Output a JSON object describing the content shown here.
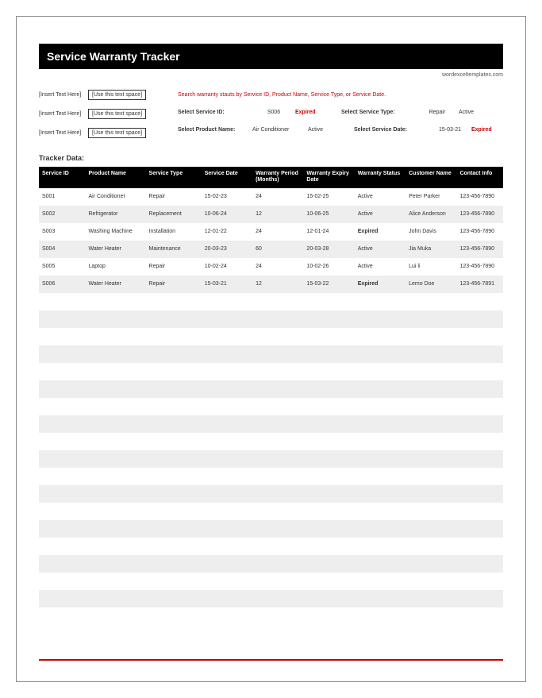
{
  "header": {
    "title": "Service Warranty Tracker",
    "source": "wordexceltemplates.com"
  },
  "left_filters": [
    {
      "label": "[Insert Text Here]",
      "box": "[Use this text space]"
    },
    {
      "label": "[Insert Text Here]",
      "box": "[Use this text space]"
    },
    {
      "label": "[Insert Text Here]",
      "box": "[Use this text space]"
    }
  ],
  "search": {
    "hint": "Search warranty stauts by Service ID, Product Name, Service Type, or Service Date.",
    "row1": {
      "label1": "Select Service ID:",
      "val1": "S006",
      "status1": "Expired",
      "label2": "Select Service Type:",
      "val2": "Repair",
      "status2": "Active"
    },
    "row2": {
      "label1": "Select Product Name:",
      "val1": "Air Conditioner",
      "status1": "Active",
      "label2": "Select Service Date:",
      "val2": "15-03-21",
      "status2": "Expired"
    }
  },
  "section_label": "Tracker Data:",
  "columns": {
    "c1": "Service ID",
    "c2": "Product Name",
    "c3": "Service Type",
    "c4": "Service Date",
    "c5": "Warranty Period (Months)",
    "c6": "Warranty Expiry Date",
    "c7": "Warranty Status",
    "c8": "Customer Name",
    "c9": "Contact Info"
  },
  "rows": [
    {
      "sid": "S001",
      "pname": "Air Conditioner",
      "stype": "Repair",
      "sdate": "15-02-23",
      "wp": "24",
      "wed": "15-02-25",
      "wstat": "Active",
      "cname": "Peter Parker",
      "cinfo": "123-456-7890"
    },
    {
      "sid": "S002",
      "pname": "Refrigerator",
      "stype": "Replacement",
      "sdate": "10-06-24",
      "wp": "12",
      "wed": "10-06-25",
      "wstat": "Active",
      "cname": "Alice Anderson",
      "cinfo": "123-456-7890"
    },
    {
      "sid": "S003",
      "pname": "Washing Machine",
      "stype": "Installation",
      "sdate": "12-01-22",
      "wp": "24",
      "wed": "12-01-24",
      "wstat": "Expired",
      "cname": "John Davis",
      "cinfo": "123-456-7890"
    },
    {
      "sid": "S004",
      "pname": "Water Heater",
      "stype": "Maintenance",
      "sdate": "20-03-23",
      "wp": "60",
      "wed": "20-03-28",
      "wstat": "Active",
      "cname": "Jia Muka",
      "cinfo": "123-456-7890"
    },
    {
      "sid": "S005",
      "pname": "Laptop",
      "stype": "Repair",
      "sdate": "10-02-24",
      "wp": "24",
      "wed": "10-02-26",
      "wstat": "Active",
      "cname": "Lui li",
      "cinfo": "123-456-7890"
    },
    {
      "sid": "S006",
      "pname": "Water Heater",
      "stype": "Repair",
      "sdate": "15-03-21",
      "wp": "12",
      "wed": "15-03-22",
      "wstat": "Expired",
      "cname": "Lemo Doe",
      "cinfo": "123-456-7891"
    }
  ],
  "empty_rows": 18
}
